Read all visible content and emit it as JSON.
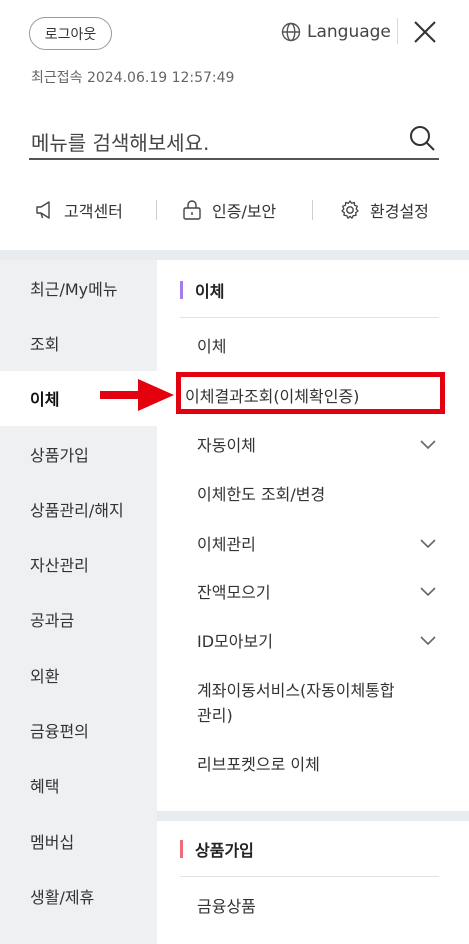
{
  "header": {
    "logout_label": "로그아웃",
    "language_label": "Language",
    "last_login": "최근접속 2024.06.19 12:57:49"
  },
  "search": {
    "placeholder": "메뉴를 검색해보세요."
  },
  "quick_links": [
    {
      "label": "고객센터",
      "icon": "megaphone-icon"
    },
    {
      "label": "인증/보안",
      "icon": "lock-icon"
    },
    {
      "label": "환경설정",
      "icon": "gear-icon"
    }
  ],
  "left_nav": [
    "최근/My메뉴",
    "조회",
    "이체",
    "상품가입",
    "상품관리/해지",
    "자산관리",
    "공과금",
    "외환",
    "금융편의",
    "혜택",
    "멤버십",
    "생활/제휴"
  ],
  "active_nav": "이체",
  "sections": [
    {
      "title": "이체",
      "accent": "#a47ee8",
      "items": [
        {
          "label": "이체",
          "expandable": false
        },
        {
          "label": "이체결과조회(이체확인증)",
          "expandable": false,
          "highlighted": true
        },
        {
          "label": "자동이체",
          "expandable": true
        },
        {
          "label": "이체한도 조회/변경",
          "expandable": false
        },
        {
          "label": "이체관리",
          "expandable": true
        },
        {
          "label": "잔액모으기",
          "expandable": true
        },
        {
          "label": "ID모아보기",
          "expandable": true
        },
        {
          "label_line1": "계좌이동서비스(자동이체통합",
          "label_line2": "관리)",
          "expandable": false
        },
        {
          "label": "리브포켓으로 이체",
          "expandable": false
        }
      ]
    },
    {
      "title": "상품가입",
      "accent": "#ee6b7a",
      "items": [
        {
          "label": "금융상품",
          "expandable": false
        }
      ]
    }
  ],
  "annotation": {
    "highlight_color": "#e3000f"
  }
}
